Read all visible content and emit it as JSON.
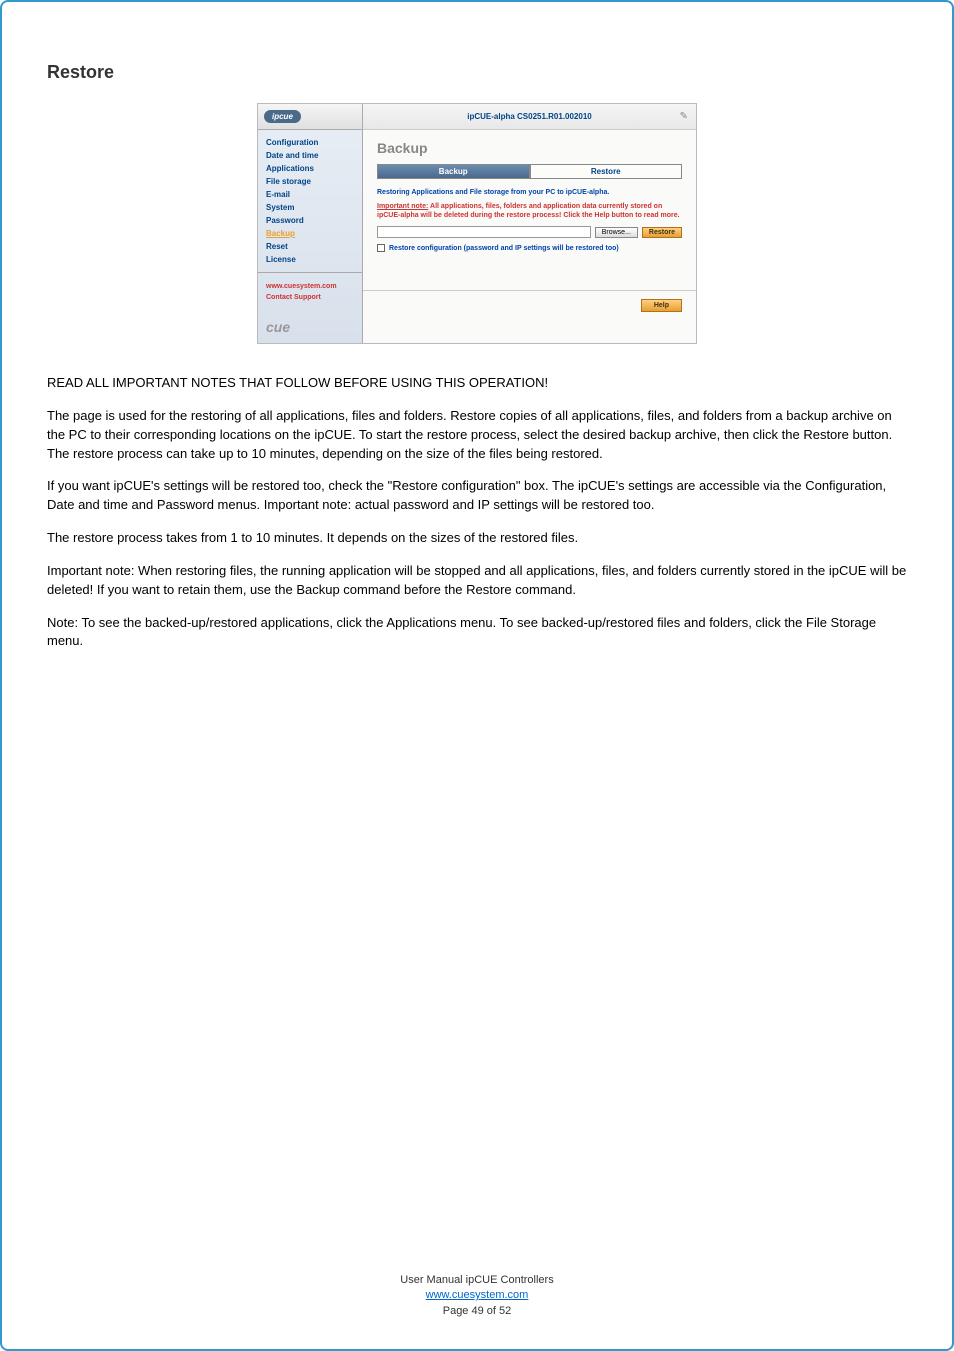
{
  "sectionTitle": "Restore",
  "app": {
    "logoText": "ipcue",
    "headerTitle": "ipCUE-alpha   CS0251.R01.002010",
    "nav": {
      "items": [
        {
          "label": "Configuration"
        },
        {
          "label": "Date and time"
        },
        {
          "label": "Applications"
        },
        {
          "label": "File storage"
        },
        {
          "label": "E-mail"
        },
        {
          "label": "System"
        },
        {
          "label": "Password"
        },
        {
          "label": "Backup",
          "active": true
        },
        {
          "label": "Reset"
        },
        {
          "label": "License"
        }
      ],
      "footerLinks": [
        "www.cuesystem.com",
        "Contact Support"
      ],
      "brandText": "cue"
    },
    "panel": {
      "title": "Backup",
      "tabs": {
        "backup": "Backup",
        "restore": "Restore"
      },
      "line1": "Restoring Applications and File storage from your PC to ipCUE-alpha.",
      "line2_prefix": "Important note:",
      "line2_rest": " All applications, files, folders and application data currently stored on ipCUE-alpha will be deleted during the restore process! Click the Help button to read more.",
      "browseBtn": "Browse...",
      "restoreBtn": "Restore",
      "checkLabel": "Restore configuration (password and IP settings will be restored too)",
      "helpBtn": "Help"
    }
  },
  "body": {
    "p1": "READ ALL IMPORTANT NOTES THAT FOLLOW BEFORE USING THIS OPERATION!",
    "p2": "The page is used for the restoring of all applications, files and folders. Restore copies of all applications, files, and folders from a backup archive on the PC to their corresponding locations on the ipCUE. To start the restore process, select the desired backup archive, then click the Restore button. The restore process can take up to 10 minutes, depending on the size of the files being restored.",
    "p3": "If you want ipCUE's settings will be restored too, check the \"Restore configuration\" box. The ipCUE's settings are accessible via the Configuration, Date and time and Password menus. Important note: actual password and IP settings will be restored too.",
    "p4": "The restore process takes from 1 to 10 minutes. It depends on the sizes of the restored files.",
    "p5": "Important note: When restoring files, the running application will be stopped and all applications, files, and folders currently stored in the ipCUE will be deleted! If you want to retain them, use the Backup command before the Restore command.",
    "p6": "Note: To see the backed-up/restored applications, click the Applications menu. To see backed-up/restored files and folders, click the File Storage menu."
  },
  "footer": {
    "line1": "User Manual ipCUE Controllers",
    "link": "www.cuesystem.com",
    "line3": "Page 49 of 52"
  }
}
